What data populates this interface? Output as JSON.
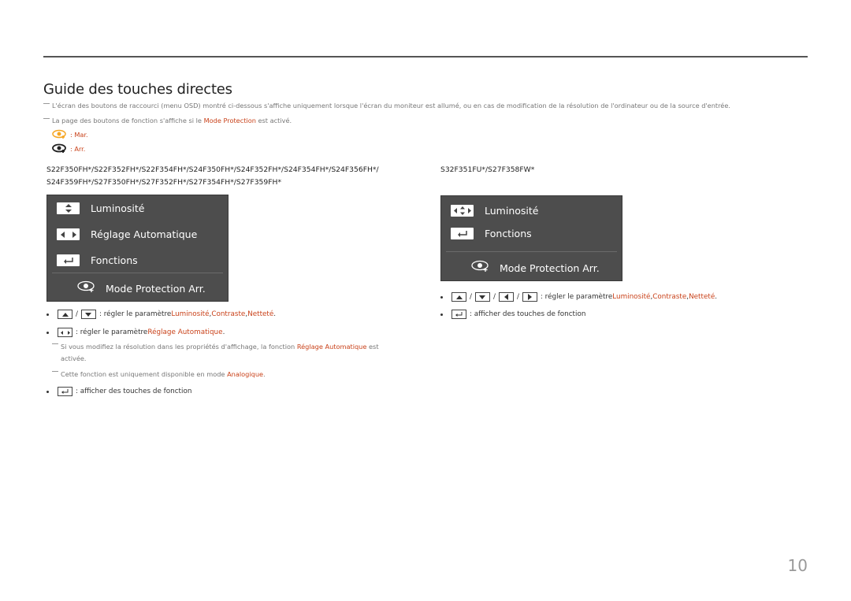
{
  "page": {
    "title": "Guide des touches directes",
    "page_number": "10"
  },
  "notes": [
    {
      "text": "L'écran des boutons de raccourci (menu OSD) montré ci-dessous s'affiche uniquement lorsque l'écran du moniteur est allumé, ou en cas de modification de la résolution de l'ordinateur ou de la source d'entrée."
    },
    {
      "before": "La page des boutons de fonction s'affiche si le ",
      "highlight": "Mode Protection",
      "after": " est activé."
    }
  ],
  "legend": [
    {
      "icon": "eye-protection-on-icon",
      "color": "#f5a623",
      "label": ": Mar."
    },
    {
      "icon": "eye-protection-off-icon",
      "color": "#222222",
      "label": ": Arr."
    }
  ],
  "left": {
    "models_line1": "S22F350FH*/S22F352FH*/S22F354FH*/S24F350FH*/S24F352FH*/S24F354FH*/S24F356FH*/",
    "models_line2": "S24F359FH*/S27F350FH*/S27F352FH*/S27F354FH*/S27F359FH*",
    "osd": {
      "items": [
        {
          "icon": "up-down-arrows-icon",
          "label": "Luminosité"
        },
        {
          "icon": "left-right-arrows-icon",
          "label": "Réglage Automatique"
        },
        {
          "icon": "enter-return-icon",
          "label": "Fonctions"
        }
      ],
      "mode_label": "Mode Protection Arr."
    },
    "bullets": {
      "b1_text": ": régler le paramètre ",
      "b1_hl1": "Luminosité",
      "b1_sep1": ", ",
      "b1_hl2": "Contraste",
      "b1_sep2": ", ",
      "b1_hl3": "Netteté",
      "b1_end": ".",
      "b2_text": ": régler le paramètre ",
      "b2_hl": "Réglage Automatique",
      "b2_end": ".",
      "sub1_before": "Si vous modifiez la résolution dans les propriétés d'affichage, la fonction ",
      "sub1_hl": "Réglage Automatique",
      "sub1_after": " est",
      "sub1_line2": "activée.",
      "sub2_before": "Cette fonction est uniquement disponible en mode ",
      "sub2_hl": "Analogique",
      "sub2_after": ".",
      "b3_text": ": afficher des touches de fonction"
    }
  },
  "right": {
    "models": "S32F351FU*/S27F358FW*",
    "osd": {
      "items": [
        {
          "icon": "four-way-arrows-icon",
          "label": "Luminosité"
        },
        {
          "icon": "enter-return-icon",
          "label": "Fonctions"
        }
      ],
      "mode_label": "Mode Protection Arr."
    },
    "bullets": {
      "b1_text": ": régler le paramètre ",
      "b1_hl1": "Luminosité",
      "b1_sep1": ", ",
      "b1_hl2": "Contraste",
      "b1_sep2": ", ",
      "b1_hl3": "Netteté",
      "b1_end": ".",
      "b2_text": ": afficher des touches de fonction"
    }
  }
}
